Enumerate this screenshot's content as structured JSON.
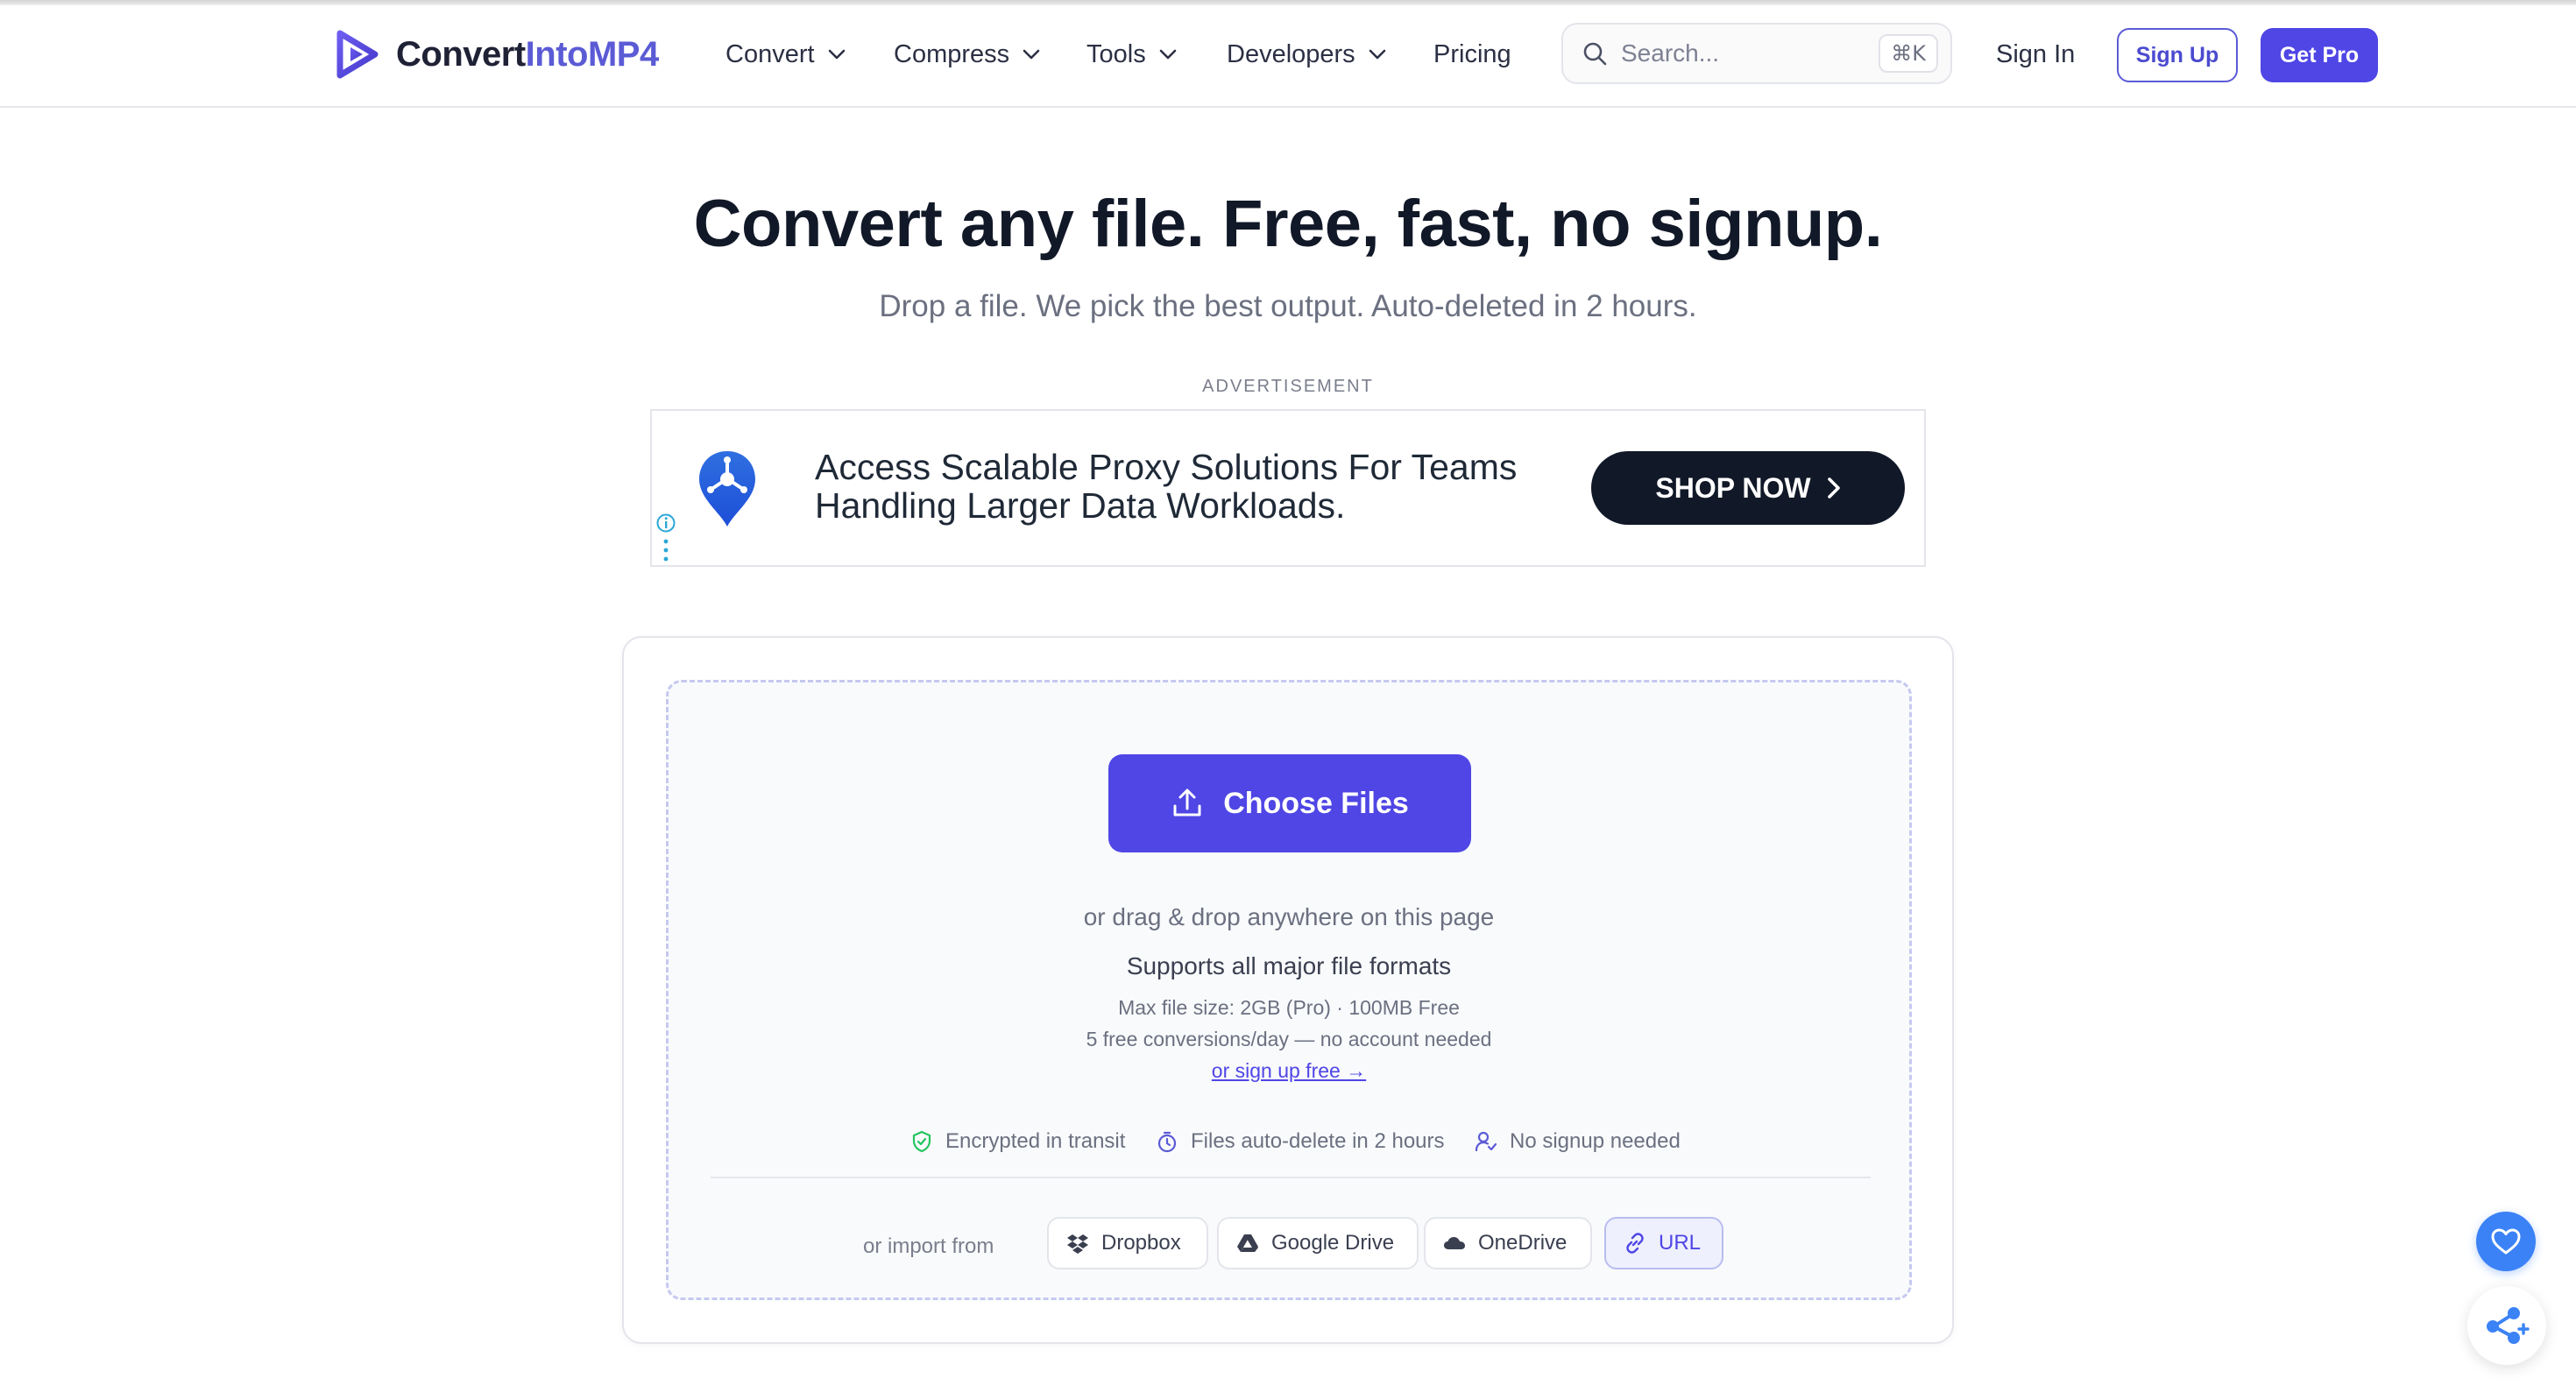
{
  "header": {
    "logo_part1": "Convert",
    "logo_part2": "IntoMP4",
    "nav": {
      "convert": "Convert",
      "compress": "Compress",
      "tools": "Tools",
      "developers": "Developers",
      "pricing": "Pricing"
    },
    "search": {
      "placeholder": "Search...",
      "shortcut": "⌘K"
    },
    "sign_in": "Sign In",
    "sign_up": "Sign Up",
    "get_pro": "Get Pro"
  },
  "hero": {
    "title": "Convert any file. Free, fast, no signup.",
    "subtitle": "Drop a file. We pick the best output. Auto-deleted in 2 hours."
  },
  "ad": {
    "label": "ADVERTISEMENT",
    "text": "Access Scalable Proxy Solutions For Teams Handling Larger Data Workloads.",
    "cta": "SHOP NOW"
  },
  "converter": {
    "choose_files": "Choose Files",
    "drag_hint": "or drag & drop anywhere on this page",
    "supports": "Supports all major file formats",
    "max_size": "Max file size: 2GB (Pro) · 100MB Free",
    "free_conversions": "5 free conversions/day — no account needed",
    "signup_link": "or sign up free →",
    "trust": {
      "encrypted": "Encrypted in transit",
      "autodelete": "Files auto-delete in 2 hours",
      "nosignup": "No signup needed"
    },
    "import_label": "or import from",
    "sources": {
      "dropbox": "Dropbox",
      "gdrive": "Google Drive",
      "onedrive": "OneDrive",
      "url": "URL"
    }
  },
  "colors": {
    "brand": "#4f46e5",
    "brand_light": "#5b5bd6",
    "ad_button": "#111827",
    "favorite": "#3b82f6",
    "trust_green": "#22c55e"
  },
  "icons": [
    "logo-play-icon",
    "chevron-down-icon",
    "search-icon",
    "upload-icon",
    "shield-check-icon",
    "timer-icon",
    "user-check-icon",
    "dropbox-icon",
    "google-drive-icon",
    "onedrive-icon",
    "link-icon",
    "heart-icon",
    "share-icon",
    "ad-info-icon",
    "ad-menu-icon",
    "chevron-right-icon"
  ]
}
